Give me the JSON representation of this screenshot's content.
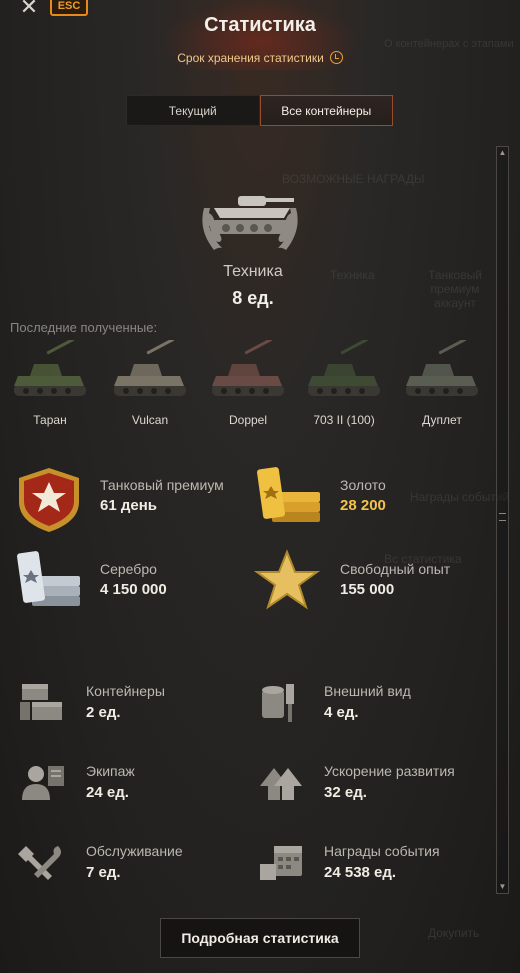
{
  "header": {
    "close_label": "✕",
    "esc_label": "ESC",
    "title": "Статистика",
    "subtitle": "Срок хранения статистики"
  },
  "tabs": [
    {
      "label": "Текущий",
      "active": false
    },
    {
      "label": "Все контейнеры",
      "active": true
    }
  ],
  "background_ghost": {
    "containers_note": "О контейнерах с этапами",
    "possible_rewards": "ВОЗМОЖНЫЕ НАГРАДЫ",
    "tech": "Техника",
    "tank_premium": "Танковый премиум аккаунт",
    "event_rewards": "Награды событий",
    "stats": "Вс статистика",
    "buy": "Докупить"
  },
  "technique": {
    "label": "Техника",
    "count": "8 ед."
  },
  "recent": {
    "label": "Последние полученные:",
    "tanks": [
      {
        "name": "Таран",
        "color": "#4e5b3a"
      },
      {
        "name": "Vulcan",
        "color": "#7a7466"
      },
      {
        "name": "Doppel",
        "color": "#6a4a44"
      },
      {
        "name": "703 II (100)",
        "color": "#3e4a33"
      },
      {
        "name": "Дуплет",
        "color": "#5a5e52"
      }
    ]
  },
  "main_rewards": [
    {
      "label": "Танковый премиум",
      "value": "61 день",
      "icon": "tank-premium-icon",
      "gold": false
    },
    {
      "label": "Золото",
      "value": "28 200",
      "icon": "gold-icon",
      "gold": true
    },
    {
      "label": "Серебро",
      "value": "4 150 000",
      "icon": "silver-icon",
      "gold": false
    },
    {
      "label": "Свободный опыт",
      "value": "155 000",
      "icon": "free-xp-icon",
      "gold": false
    }
  ],
  "other_rewards": [
    {
      "label": "Контейнеры",
      "value": "2 ед.",
      "icon": "containers-icon"
    },
    {
      "label": "Внешний вид",
      "value": "4 ед.",
      "icon": "customization-icon"
    },
    {
      "label": "Экипаж",
      "value": "24 ед.",
      "icon": "crew-icon"
    },
    {
      "label": "Ускорение развития",
      "value": "32 ед.",
      "icon": "boosters-icon"
    },
    {
      "label": "Обслуживание",
      "value": "7 ед.",
      "icon": "maintenance-icon"
    },
    {
      "label": "Награды события",
      "value": "24 538 ед.",
      "icon": "event-rewards-icon"
    }
  ],
  "details_button": "Подробная статистика",
  "colors": {
    "accent": "#f0a030",
    "gold": "#f5c24a",
    "tab_border": "#9a4a28"
  }
}
